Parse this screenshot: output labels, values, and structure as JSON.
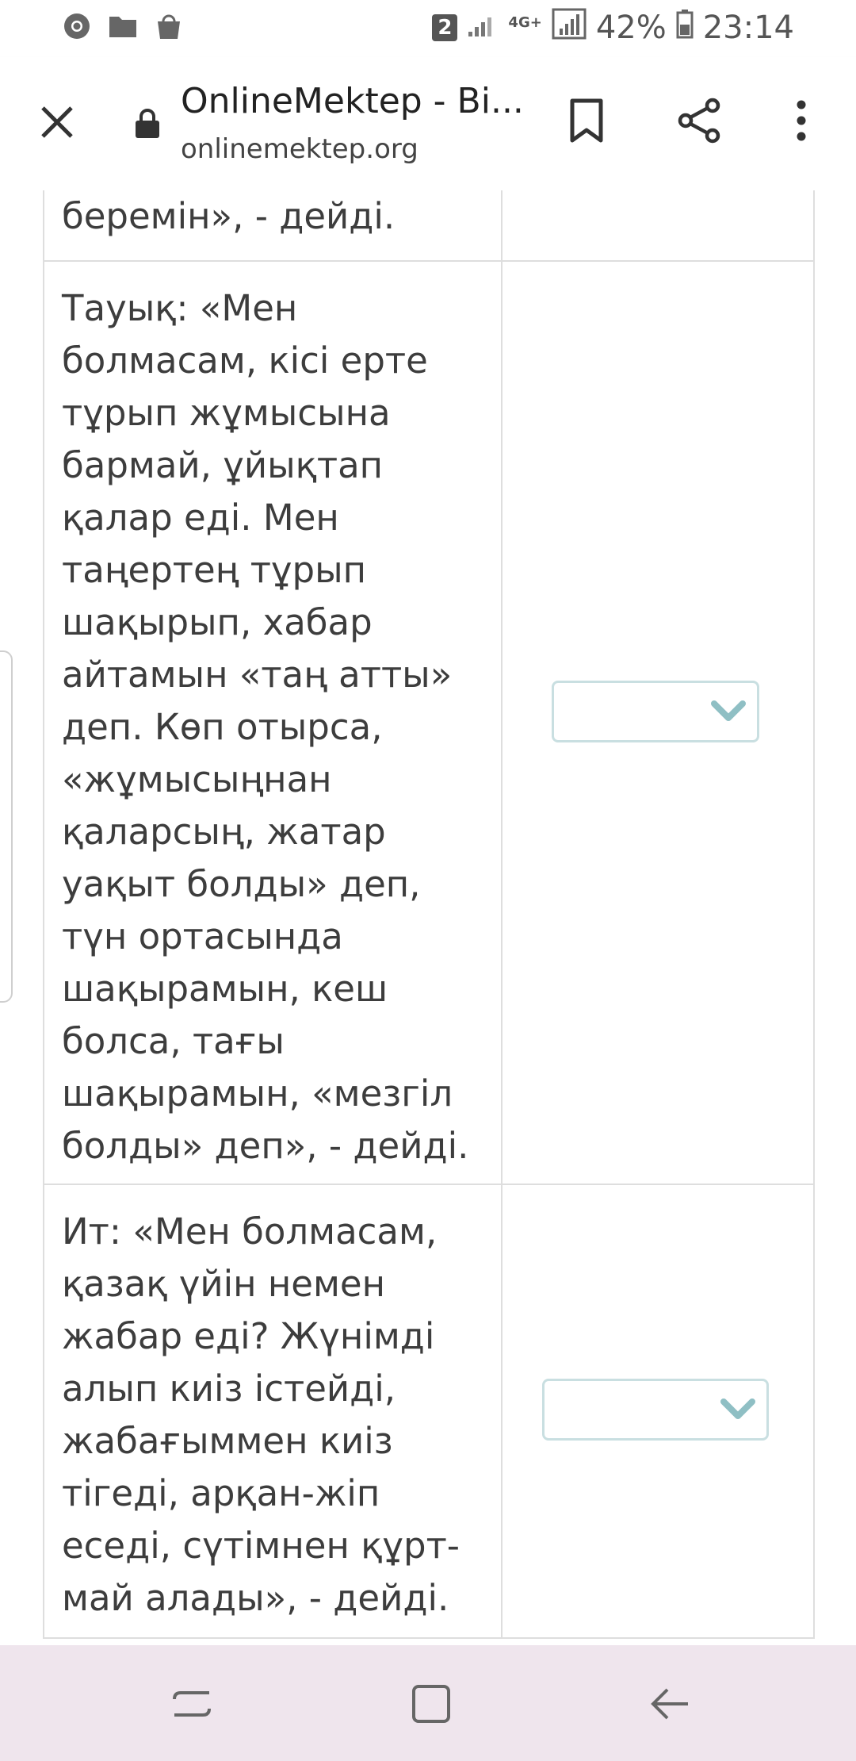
{
  "status_bar": {
    "notification_count": "2",
    "network": "4G+",
    "battery": "42%",
    "time": "23:14"
  },
  "browser": {
    "title": "OnlineMektep - Bi...",
    "url": "onlinemektep.org"
  },
  "table": {
    "rows": [
      {
        "text": "беремін», - дейді."
      },
      {
        "text": "Тауық: «Мен болмасам, кісі ерте тұрып жұмысына бармай, ұйықтап қалар еді. Мен таңертең тұрып шақырып, хабар айтамын «таң атты» деп. Көп отырса, «жұмысыңнан қаларсың, жатар уақыт болды» деп, түн ортасында шақырамын, кеш болса, тағы шақырамын, «мезгіл болды» деп», - дейді.",
        "selected": ""
      },
      {
        "text": "Ит: «Мен болмасам, қазақ үйін немен жабар еді? Жүнімді алып киіз істейді, жабағыммен киіз тігеді, арқан-жіп еседі, сүтімнен құрт-май алады», - дейді.",
        "selected": ""
      }
    ]
  },
  "colors": {
    "accent_chevron": "#8fbfc4",
    "select_border": "#c9dfe1",
    "nav_bg": "#efe5ed"
  }
}
